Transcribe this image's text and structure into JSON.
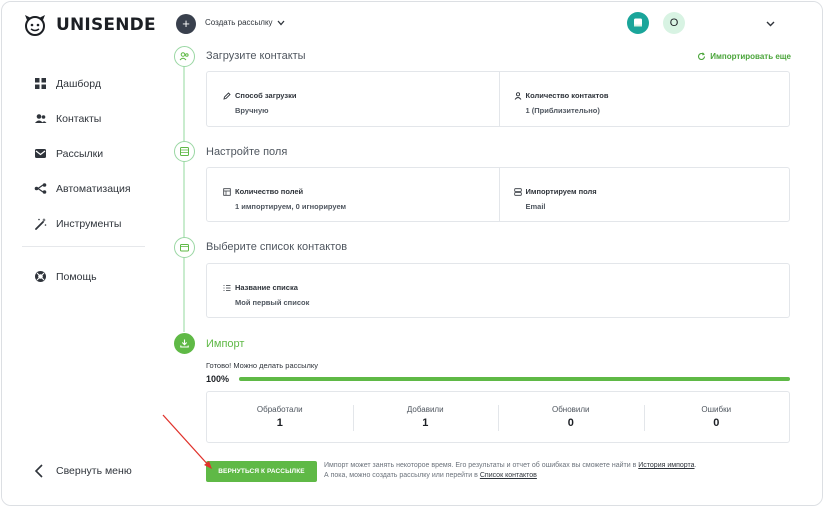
{
  "brand": {
    "name": "UNISENDER"
  },
  "sidebar": {
    "items": [
      {
        "label": "Дашборд",
        "icon": "dashboard-icon"
      },
      {
        "label": "Контакты",
        "icon": "contacts-icon"
      },
      {
        "label": "Рассылки",
        "icon": "mail-icon"
      },
      {
        "label": "Автоматизация",
        "icon": "automation-icon"
      },
      {
        "label": "Инструменты",
        "icon": "magic-wand-icon"
      }
    ],
    "help": {
      "label": "Помощь",
      "icon": "help-icon"
    },
    "collapse": {
      "label": "Свернуть меню",
      "icon": "chevron-left-icon"
    }
  },
  "header": {
    "create_label": "Создать рассылку",
    "avatar_initial": "О"
  },
  "steps": {
    "upload": {
      "title": "Загрузите контакты",
      "import_more": "Импортировать еще",
      "method_label": "Способ загрузки",
      "method_value": "Вручную",
      "count_label": "Количество контактов",
      "count_value": "1 (Приблизительно)"
    },
    "fields": {
      "title": "Настройте поля",
      "fields_label": "Количество полей",
      "fields_value": "1 импортируем, 0 игнорируем",
      "imported_label": "Импортируем поля",
      "imported_value": "Email"
    },
    "list": {
      "title": "Выберите список контактов",
      "name_label": "Название списка",
      "name_value": "Мой первый список"
    },
    "import": {
      "title": "Импорт",
      "status": "Готово! Можно делать рассылку",
      "progress_label": "100%",
      "progress": 1.0,
      "stats": [
        {
          "label": "Обработали",
          "value": "1"
        },
        {
          "label": "Добавили",
          "value": "1"
        },
        {
          "label": "Обновили",
          "value": "0"
        },
        {
          "label": "Ошибки",
          "value": "0"
        }
      ]
    }
  },
  "footer": {
    "back_button": "ВЕРНУТЬСЯ К РАССЫЛКЕ",
    "note_line1": "Импорт может занять некоторое время. Его результаты и отчет об ошибках вы сможете найти в",
    "history_link": "История импорта",
    "note_line2": "А пока, можно создать рассылку или перейти в",
    "contacts_link": "Список контактов"
  },
  "colors": {
    "accent": "#5fb946",
    "dark": "#39404d",
    "teal": "#1aa59a",
    "annotation_arrow": "#e0322b"
  }
}
